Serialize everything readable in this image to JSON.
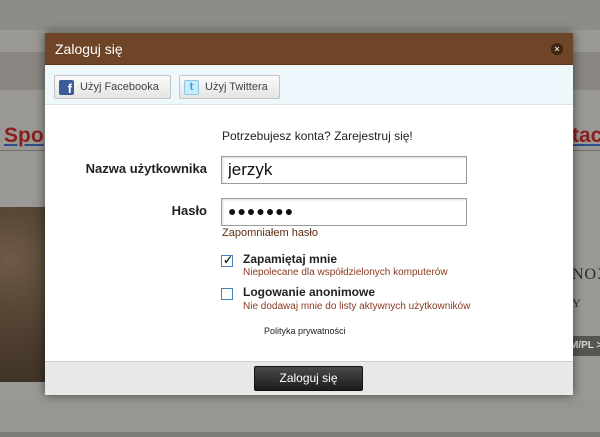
{
  "background": {
    "left_heading": "Spo",
    "right_heading": "tac",
    "brand": "NOX",
    "brand_sub": "Y",
    "lang_bar": "M/PL >"
  },
  "dialog": {
    "title": "Zaloguj się",
    "close_icon": "×"
  },
  "social": {
    "facebook_label": "Użyj Facebooka",
    "twitter_label": "Użyj Twittera"
  },
  "register_prompt": "Potrzebujesz konta? Zarejestruj się!",
  "form": {
    "username_label": "Nazwa użytkownika",
    "username_value": "jerzyk",
    "password_label": "Hasło",
    "password_display": "●●●●●●●",
    "forgot_password": "Zapomniałem hasło"
  },
  "options": {
    "remember": {
      "title": "Zapamiętaj mnie",
      "description": "Niepolecane dla współdzielonych komputerów",
      "checked": true
    },
    "anonymous": {
      "title": "Logowanie anonimowe",
      "description": "Nie dodawaj mnie do listy aktywnych użytkowników",
      "checked": false
    }
  },
  "privacy_link": "Polityka prywatności",
  "submit_label": "Zaloguj się",
  "colors": {
    "header": "#6e4526",
    "social_bar": "#eef7fb",
    "link_accent": "#8a3a20",
    "button_dark": "#1c1c1c"
  }
}
